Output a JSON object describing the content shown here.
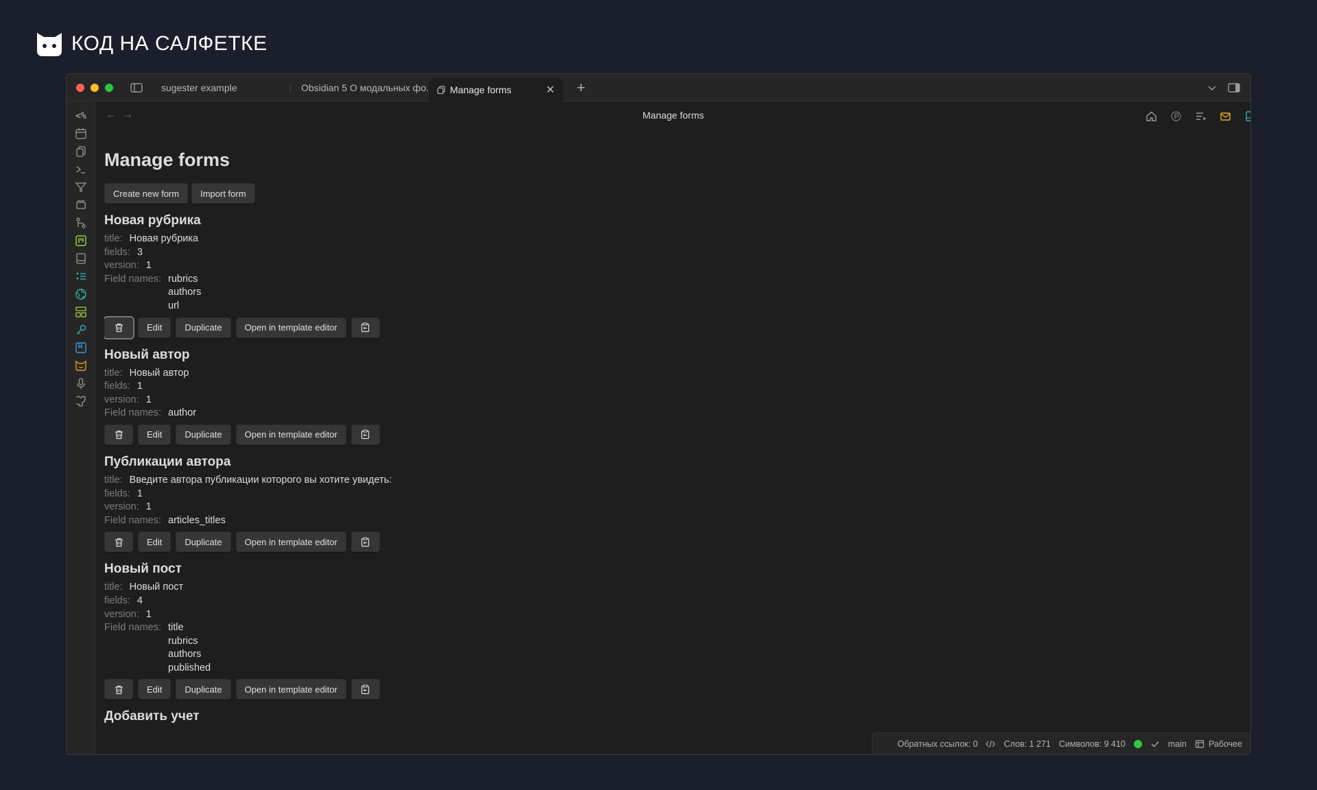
{
  "brand": {
    "text": "КОД НА САЛФЕТКЕ"
  },
  "window": {
    "traffic_colors": [
      "#ff5f57",
      "#febc2e",
      "#28c840"
    ],
    "tabs": [
      {
        "label": "sugester example"
      },
      {
        "label": "Obsidian 5 О модальных фо..."
      },
      {
        "label": "Manage forms",
        "close": "✕"
      }
    ],
    "new_tab": "+"
  },
  "ribbon": {
    "icons": [
      "templater-icon",
      "calendar-icon",
      "copy-icon",
      "terminal-icon",
      "filter-icon",
      "slides-icon",
      "git-icon",
      "kanban-icon",
      "book-icon",
      "list-icon",
      "globe-icon",
      "layout-icon",
      "key-icon",
      "bookmark-icon",
      "cat-icon",
      "mic-icon",
      "github-icon"
    ],
    "templater_text": "<%"
  },
  "view": {
    "back": "←",
    "forward": "→",
    "title": "Manage forms"
  },
  "page": {
    "heading": "Manage forms",
    "create_btn": "Create new form",
    "import_btn": "Import form"
  },
  "labels": {
    "title": "title:",
    "fields": "fields:",
    "version": "version:",
    "field_names": "Field names:",
    "edit": "Edit",
    "duplicate": "Duplicate",
    "open_template": "Open in template editor"
  },
  "forms": [
    {
      "name": "Новая рубрика",
      "title": "Новая рубрика",
      "fields": "3",
      "version": "1",
      "field_names": [
        "rubrics",
        "authors",
        "url"
      ]
    },
    {
      "name": "Новый автор",
      "title": "Новый автор",
      "fields": "1",
      "version": "1",
      "field_names": [
        "author"
      ]
    },
    {
      "name": "Публикации автора",
      "title": "Введите автора публикации которого вы хотите увидеть:",
      "fields": "1",
      "version": "1",
      "field_names": [
        "articles_titles"
      ]
    },
    {
      "name": "Новый пост",
      "title": "Новый пост",
      "fields": "4",
      "version": "1",
      "field_names": [
        "title",
        "rubrics",
        "authors",
        "published"
      ]
    },
    {
      "name": "Добавить учет"
    }
  ],
  "status": {
    "backlinks": "Обратных ссылок: 0",
    "words": "Слов: 1 271",
    "chars": "Символов: 9 410",
    "branch": "main",
    "workspace": "Рабочее",
    "sync_color": "#2ec93f"
  }
}
